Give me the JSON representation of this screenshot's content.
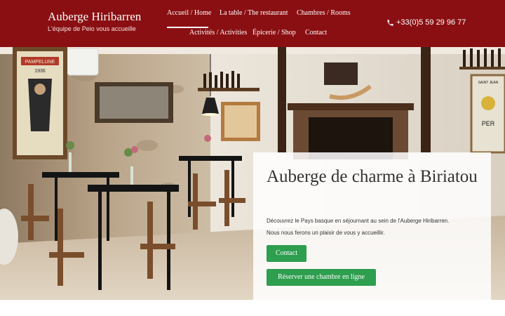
{
  "header": {
    "brand_name": "Auberge Hiribarren",
    "tagline": "L'équipe de Peio vous accueille",
    "nav": [
      "Accueil / Home",
      "La table / The restaurant",
      "Chambres / Rooms",
      "Activités / Activities",
      "Épicerie / Shop",
      "Contact"
    ],
    "phone": "+33(0)5 59 29 96 77"
  },
  "hero": {
    "title": "Auberge de charme à Biriatou",
    "line1": "Découvrez le Pays basque en séjournant au sein de l'Auberge Hiribarren.",
    "line2": "Nous nous ferons un plaisir de vous y accueillir.",
    "contact_button": "Contact",
    "book_button": "Réserver une chambre en ligne"
  },
  "poster_texts": {
    "left_poster": "PAMPELUNE",
    "left_year": "1936",
    "right_poster": "SAINT JEAN",
    "right_brand": "PER"
  },
  "colors": {
    "header": "#8a0f12",
    "button": "#2e9e4f"
  },
  "icons": {
    "phone": "phone-icon"
  }
}
